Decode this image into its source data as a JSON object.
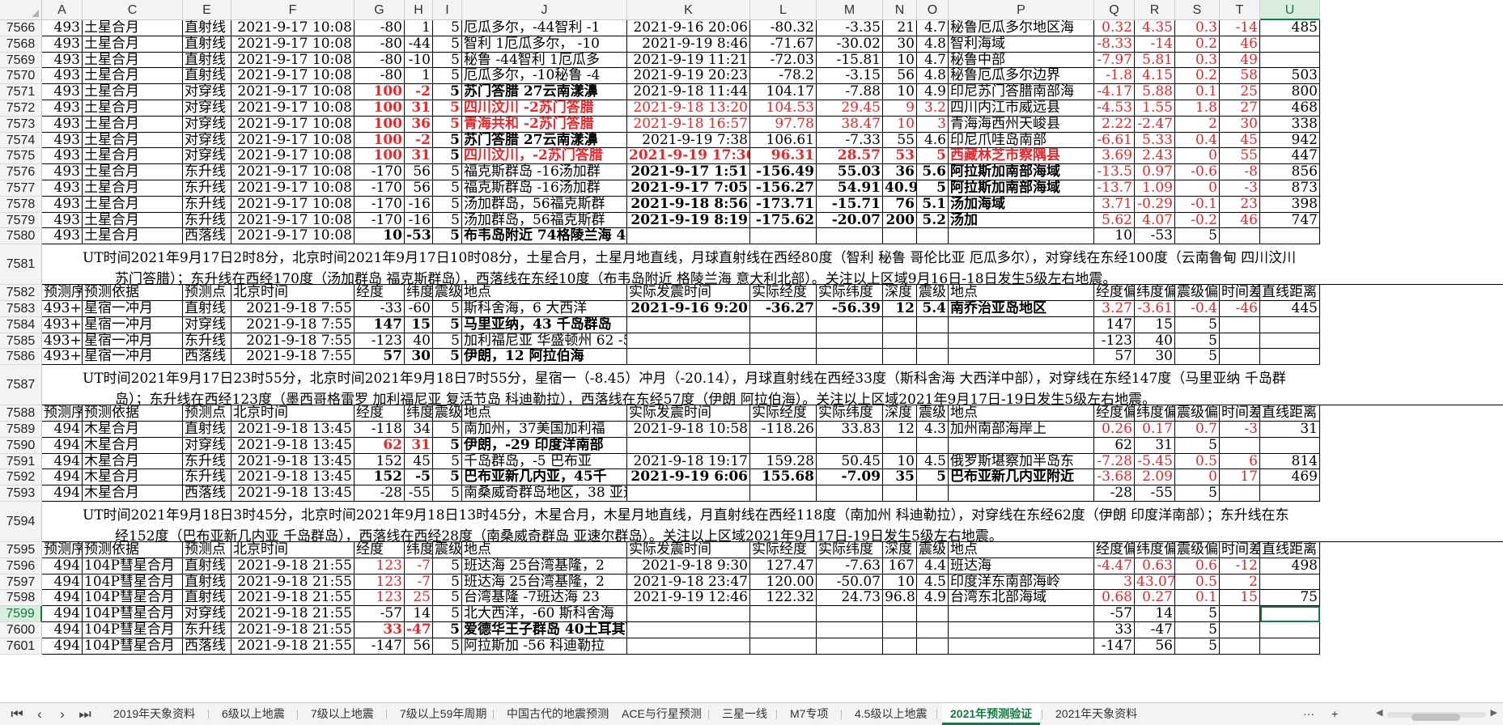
{
  "columns": [
    "A",
    "C",
    "E",
    "F",
    "G",
    "H",
    "I",
    "J",
    "K",
    "L",
    "M",
    "N",
    "O",
    "P",
    "Q",
    "R",
    "S",
    "T",
    "U"
  ],
  "selected_column": "U",
  "selected_row": "7599",
  "rows": [
    {
      "num": "7566",
      "cells": [
        "493",
        "土星合月",
        "直射线",
        "2021-9-17 10:08",
        "-80",
        "1",
        "5",
        "厄瓜多尔，-44智利 -1",
        "2021-9-16 20:06",
        "-80.32",
        "-3.35",
        "21",
        "4.7",
        "秘鲁厄瓜多尔地区海",
        "0.32",
        "4.35",
        "0.3",
        "-14",
        "485"
      ]
    },
    {
      "num": "7568",
      "cells": [
        "493",
        "土星合月",
        "直射线",
        "2021-9-17 10:08",
        "-80",
        "-44",
        "5",
        "智利 1厄瓜多尔， -10",
        "2021-9-19 8:46",
        "-71.67",
        "-30.02",
        "30",
        "4.8",
        "智利海域",
        "-8.33",
        "-14",
        "0.2",
        "46",
        ""
      ]
    },
    {
      "num": "7569",
      "cells": [
        "493",
        "土星合月",
        "直射线",
        "2021-9-17 10:08",
        "-80",
        "-10",
        "5",
        "秘鲁 -44智利 1厄瓜多",
        "2021-9-19 11:21",
        "-72.03",
        "-15.81",
        "10",
        "4.7",
        "秘鲁中部",
        "-7.97",
        "5.81",
        "0.3",
        "49",
        ""
      ]
    },
    {
      "num": "7570",
      "cells": [
        "493",
        "土星合月",
        "直射线",
        "2021-9-17 10:08",
        "-80",
        "1",
        "5",
        "厄瓜多尔，-10秘鲁 -4",
        "2021-9-19 20:23",
        "-78.2",
        "-3.15",
        "56",
        "4.8",
        "秘鲁厄瓜多尔边界",
        "-1.8",
        "4.15",
        "0.2",
        "58",
        "503"
      ]
    },
    {
      "num": "7571",
      "cells": [
        "493",
        "土星合月",
        "对穿线",
        "2021-9-17 10:08",
        "100",
        "-2",
        "5",
        "苏门答腊 27云南漾濞",
        "2021-9-18 11:44",
        "104.17",
        "-7.88",
        "10",
        "4.9",
        "印尼苏门答腊南部海",
        "-4.17",
        "5.88",
        "0.1",
        "25",
        "800"
      ]
    },
    {
      "num": "7572",
      "cells": [
        "493",
        "土星合月",
        "对穿线",
        "2021-9-17 10:08",
        "100",
        "31",
        "5",
        "四川汶川 -2苏门答腊",
        "2021-9-18 13:20",
        "104.53",
        "29.45",
        "9",
        "3.2",
        "四川内江市威远县",
        "-4.53",
        "1.55",
        "1.8",
        "27",
        "468"
      ]
    },
    {
      "num": "7573",
      "cells": [
        "493",
        "土星合月",
        "对穿线",
        "2021-9-17 10:08",
        "100",
        "36",
        "5",
        "青海共和 -2苏门答腊",
        "2021-9-18 16:57",
        "97.78",
        "38.47",
        "10",
        "3",
        "青海海西州天峻县",
        "2.22",
        "-2.47",
        "2",
        "30",
        "338"
      ]
    },
    {
      "num": "7574",
      "cells": [
        "493",
        "土星合月",
        "对穿线",
        "2021-9-17 10:08",
        "100",
        "-2",
        "5",
        "苏门答腊 27云南漾濞",
        "2021-9-19 7:38",
        "106.61",
        "-7.33",
        "55",
        "4.6",
        "印尼爪哇岛南部",
        "-6.61",
        "5.33",
        "0.4",
        "45",
        "942"
      ]
    },
    {
      "num": "7575",
      "cells": [
        "493",
        "土星合月",
        "对穿线",
        "2021-9-17 10:08",
        "100",
        "31",
        "5",
        "四川汶川，-2苏门答腊",
        "2021-9-19 17:36",
        "96.31",
        "28.57",
        "53",
        "5",
        "西藏林芝市察隅县",
        "3.69",
        "2.43",
        "0",
        "55",
        "447"
      ]
    },
    {
      "num": "7576",
      "cells": [
        "493",
        "土星合月",
        "东升线",
        "2021-9-17 10:08",
        "-170",
        "56",
        "5",
        "福克斯群岛 -16汤加群",
        "2021-9-17 1:51",
        "-156.49",
        "55.03",
        "36",
        "5.6",
        "阿拉斯加南部海域",
        "-13.5",
        "0.97",
        "-0.6",
        "-8",
        "856"
      ]
    },
    {
      "num": "7577",
      "cells": [
        "493",
        "土星合月",
        "东升线",
        "2021-9-17 10:08",
        "-170",
        "56",
        "5",
        "福克斯群岛 -16汤加群",
        "2021-9-17 7:05",
        "-156.27",
        "54.91",
        "40.9",
        "5",
        "阿拉斯加南部海域",
        "-13.7",
        "1.09",
        "0",
        "-3",
        "873"
      ]
    },
    {
      "num": "7578",
      "cells": [
        "493",
        "土星合月",
        "东升线",
        "2021-9-17 10:08",
        "-170",
        "-16",
        "5",
        "汤加群岛，56福克斯群",
        "2021-9-18 8:56",
        "-173.71",
        "-15.71",
        "76",
        "5.1",
        "汤加海域",
        "3.71",
        "-0.29",
        "-0.1",
        "23",
        "398"
      ]
    },
    {
      "num": "7579",
      "cells": [
        "493",
        "土星合月",
        "东升线",
        "2021-9-17 10:08",
        "-170",
        "-16",
        "5",
        "汤加群岛，56福克斯群",
        "2021-9-19 8:19",
        "-175.62",
        "-20.07",
        "200",
        "5.2",
        "汤加",
        "5.62",
        "4.07",
        "-0.2",
        "46",
        "747"
      ]
    },
    {
      "num": "7580",
      "cells": [
        "493",
        "土星合月",
        "西落线",
        "2021-9-17 10:08",
        "10",
        "-53",
        "5",
        "布韦岛附近 74格陵兰海 44意大利北部",
        "",
        "",
        "",
        "",
        "",
        "",
        "10",
        "-53",
        "5",
        "",
        ""
      ]
    },
    {
      "num": "7581",
      "note": [
        "UT时间2021年9月17日2时8分，北京时间2021年9月17日10时08分，土星合月，土星月地直线，月球直射线在西经80度（智利 秘鲁 哥伦比亚 厄瓜多尔），对穿线在东经100度（云南鲁甸 四川汶川",
        "苏门答腊）；东升线在西经170度（汤加群岛 福克斯群岛），西落线在东经10度（布韦岛附近 格陵兰海 意大利北部）。关注以上区域9月16日-18日发生5级左右地震。"
      ]
    },
    {
      "num": "7582",
      "header": true,
      "cells": [
        "预测序",
        "预测依据",
        "预测点",
        "北京时间",
        "经度",
        "纬度",
        "震级",
        "地点",
        "实际发震时间",
        "实际经度",
        "实际纬度",
        "深度",
        "震级",
        "地点",
        "经度偏",
        "纬度偏",
        "震级偏",
        "时间差",
        "直线距离"
      ]
    },
    {
      "num": "7583",
      "cells": [
        "493+1",
        "星宿一冲月",
        "直射线",
        "2021-9-18 7:55",
        "-33",
        "-60",
        "5",
        "斯科舍海，6 大西洋",
        "2021-9-16 9:20",
        "-36.27",
        "-56.39",
        "12",
        "5.4",
        "南乔治亚岛地区",
        "3.27",
        "-3.61",
        "-0.4",
        "-46",
        "445"
      ]
    },
    {
      "num": "7584",
      "cells": [
        "493+1",
        "星宿一冲月",
        "对穿线",
        "2021-9-18 7:55",
        "147",
        "15",
        "5",
        "马里亚纳，43 千岛群岛",
        "",
        "",
        "",
        "",
        "",
        "",
        "147",
        "15",
        "5",
        "",
        ""
      ]
    },
    {
      "num": "7585",
      "cells": [
        "493+1",
        "星宿一冲月",
        "东升线",
        "2021-9-18 7:55",
        "-123",
        "40",
        "5",
        "加利福尼亚 华盛顿州 62 -56复活节岛科迪勒拉",
        "",
        "",
        "",
        "",
        "",
        "",
        "-123",
        "40",
        "5",
        "",
        ""
      ]
    },
    {
      "num": "7586",
      "cells": [
        "493+1",
        "星宿一冲月",
        "西落线",
        "2021-9-18 7:55",
        "57",
        "30",
        "5",
        "伊朗，12 阿拉伯海",
        "",
        "",
        "",
        "",
        "",
        "",
        "57",
        "30",
        "5",
        "",
        ""
      ]
    },
    {
      "num": "7587",
      "note": [
        "UT时间2021年9月17日23时55分，北京时间2021年9月18日7时55分，星宿一（-8.45）冲月（-20.14），月球直射线在西经33度（斯科舍海 大西洋中部），对穿线在东经147度（马里亚纳 千岛群",
        "岛）；东升线在西经123度（墨西哥格雷罗 加利福尼亚 复活节岛 科迪勒拉），西落线在东经57度（伊朗 阿拉伯海）。关注以上区域2021年9月17日-19日发生5级左右地震。"
      ]
    },
    {
      "num": "7588",
      "header": true,
      "cells": [
        "预测序",
        "预测依据",
        "预测点",
        "北京时间",
        "经度",
        "纬度",
        "震级",
        "地点",
        "实际发震时间",
        "实际经度",
        "实际纬度",
        "深度",
        "震级",
        "地点",
        "经度偏",
        "纬度偏",
        "震级偏",
        "时间差",
        "直线距离"
      ]
    },
    {
      "num": "7589",
      "cells": [
        "494",
        "木星合月",
        "直射线",
        "2021-9-18 13:45",
        "-118",
        "34",
        "5",
        "南加州，37美国加利福",
        "2021-9-18 10:58",
        "-118.26",
        "33.83",
        "12",
        "4.3",
        "加州南部海岸上",
        "0.26",
        "0.17",
        "0.7",
        "-3",
        "31"
      ]
    },
    {
      "num": "7590",
      "cells": [
        "494",
        "木星合月",
        "对穿线",
        "2021-9-18 13:45",
        "62",
        "31",
        "5",
        "伊朗，-29 印度洋南部",
        "",
        "",
        "",
        "",
        "",
        "",
        "62",
        "31",
        "5",
        "",
        ""
      ]
    },
    {
      "num": "7591",
      "cells": [
        "494",
        "木星合月",
        "东升线",
        "2021-9-18 13:45",
        "152",
        "45",
        "5",
        "千岛群岛，-5 巴布亚",
        "2021-9-18 19:17",
        "159.28",
        "50.45",
        "10",
        "4.5",
        "俄罗斯堪察加半岛东",
        "-7.28",
        "-5.45",
        "0.5",
        "6",
        "814"
      ]
    },
    {
      "num": "7592",
      "cells": [
        "494",
        "木星合月",
        "东升线",
        "2021-9-18 13:45",
        "152",
        "-5",
        "5",
        "巴布亚新几内亚，45千",
        "2021-9-19 6:06",
        "155.68",
        "-7.09",
        "35",
        "5",
        "巴布亚新几内亚附近",
        "-3.68",
        "2.09",
        "0",
        "17",
        "469"
      ]
    },
    {
      "num": "7593",
      "cells": [
        "494",
        "木星合月",
        "西落线",
        "2021-9-18 13:45",
        "-28",
        "-55",
        "5",
        "南桑威奇群岛地区，38 亚速尔群岛",
        "",
        "",
        "",
        "",
        "",
        "",
        "-28",
        "-55",
        "5",
        "",
        ""
      ]
    },
    {
      "num": "7594",
      "note": [
        "UT时间2021年9月18日3时45分，北京时间2021年9月18日13时45分，木星合月，木星月地直线，月直射线在西经118度（南加州 科迪勒拉），对穿线在东经62度（伊朗 印度洋南部）；东升线在东",
        "经152度（巴布亚新几内亚 千岛群岛），西落线在西经28度（南桑威奇群岛 亚速尔群岛）。关注以上区域2021年9月17日-19日发生5级左右地震。"
      ]
    },
    {
      "num": "7595",
      "header": true,
      "cells": [
        "预测序",
        "预测依据",
        "预测点",
        "北京时间",
        "经度",
        "纬度",
        "震级",
        "地点",
        "实际发震时间",
        "实际经度",
        "实际纬度",
        "深度",
        "震级",
        "地点",
        "经度偏",
        "纬度偏",
        "震级偏",
        "时间差",
        "直线距离"
      ]
    },
    {
      "num": "7596",
      "cells": [
        "494",
        "104P彗星合月",
        "直射线",
        "2021-9-18 21:55",
        "123",
        "-7",
        "5",
        "班达海 25台湾基隆，2",
        "2021-9-18 9:30",
        "127.47",
        "-7.63",
        "167",
        "4.4",
        "班达海",
        "-4.47",
        "0.63",
        "0.6",
        "-12",
        "498"
      ]
    },
    {
      "num": "7597",
      "cells": [
        "494",
        "104P彗星合月",
        "直射线",
        "2021-9-18 21:55",
        "123",
        "-7",
        "5",
        "班达海 25台湾基隆，2",
        "2021-9-18 23:47",
        "120.00",
        "-50.07",
        "10",
        "4.5",
        "印度洋东南部海岭",
        "3",
        "43.07",
        "0.5",
        "2",
        ""
      ]
    },
    {
      "num": "7598",
      "cells": [
        "494",
        "104P彗星合月",
        "直射线",
        "2021-9-18 21:55",
        "123",
        "25",
        "5",
        "台湾基隆 -7班达海 23",
        "2021-9-19 12:46",
        "122.32",
        "24.73",
        "96.8",
        "4.9",
        "台湾东北部海域",
        "0.68",
        "0.27",
        "0.1",
        "15",
        "75"
      ]
    },
    {
      "num": "7599",
      "cells": [
        "494",
        "104P彗星合月",
        "对穿线",
        "2021-9-18 21:55",
        "-57",
        "14",
        "5",
        "北大西洋，-60 斯科舍海",
        "",
        "",
        "",
        "",
        "",
        "",
        "-57",
        "14",
        "5",
        "",
        ""
      ]
    },
    {
      "num": "7600",
      "cells": [
        "494",
        "104P彗星合月",
        "东升线",
        "2021-9-18 21:55",
        "33",
        "-47",
        "5",
        "爱德华王子群岛 40土耳其西部，",
        "",
        "",
        "",
        "",
        "",
        "",
        "33",
        "-47",
        "5",
        "",
        ""
      ]
    },
    {
      "num": "7601",
      "cells": [
        "494",
        "104P彗星合月",
        "西落线",
        "2021-9-18 21:55",
        "-147",
        "56",
        "5",
        "阿拉斯加 -56 科迪勒拉",
        "",
        "",
        "",
        "",
        "",
        "",
        "-147",
        "56",
        "5",
        "",
        ""
      ]
    }
  ],
  "first_header": [
    "预测序",
    "预测依据",
    "预测点",
    "北京时间",
    "经度",
    "纬度",
    "震级",
    "地点",
    "实际发震时间",
    "实际经度",
    "实际纬度",
    "深度",
    "震级",
    "地点",
    "经度偏",
    "纬度偏",
    "震级偏",
    "时间差",
    "直线距离"
  ],
  "styles": {
    "red_rows": {
      "7572": [
        7,
        8,
        9,
        10,
        11,
        12,
        13
      ],
      "7573": [
        7,
        8,
        9,
        10,
        11,
        12,
        13
      ],
      "7575": [
        8
      ]
    },
    "bold_rows": [
      "7571",
      "7572",
      "7573",
      "7574",
      "7575",
      "7580",
      "7584",
      "7586",
      "7590",
      "7592",
      "7600"
    ],
    "bold_actual_rows": [
      "7575",
      "7576",
      "7577",
      "7578",
      "7579",
      "7583",
      "7592"
    ],
    "red_value_rows": [
      "7571",
      "7572",
      "7573",
      "7574",
      "7575",
      "7590",
      "7596",
      "7597",
      "7598",
      "7600"
    ],
    "colors": {
      "red": "#e8262b",
      "accent": "#107c41",
      "header_bg": "#f3f3f3"
    }
  },
  "tabs": {
    "nav_icons": [
      "first-sheet-icon",
      "prev-sheet-icon",
      "next-sheet-icon",
      "last-sheet-icon"
    ],
    "items": [
      "2019年天象资料",
      "6级以上地震",
      "7级以上地震",
      "7级以上59年周期",
      "中国古代的地震预测",
      "ACE与行星预测",
      "三星一线",
      "M7专项",
      "4.5级以上地震",
      "2021年预测验证",
      "2021年天象资料"
    ],
    "active": "2021年预测验证",
    "more": "···",
    "add": "+"
  }
}
